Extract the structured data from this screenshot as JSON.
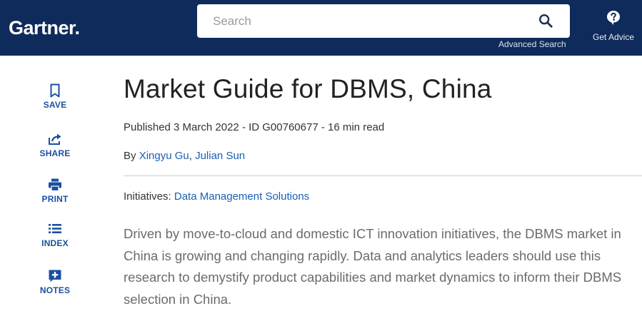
{
  "header": {
    "logo": "Gartner",
    "logo_dot": ".",
    "search": {
      "placeholder": "Search"
    },
    "advanced_search": "Advanced Search",
    "get_advice": "Get Advice",
    "colors": {
      "bar": "#0f2b5b",
      "accent": "#1a5fb4"
    }
  },
  "rail": {
    "save": {
      "label": "SAVE",
      "icon": "bookmark-icon"
    },
    "share": {
      "label": "SHARE",
      "icon": "share-icon"
    },
    "print": {
      "label": "PRINT",
      "icon": "print-icon"
    },
    "index": {
      "label": "INDEX",
      "icon": "list-icon"
    },
    "notes": {
      "label": "NOTES",
      "icon": "add-note-icon"
    }
  },
  "article": {
    "title": "Market Guide for DBMS, China",
    "meta": "Published 3 March 2022 - ID G00760677 - 16 min read",
    "by_prefix": "By ",
    "authors": [
      "Xingyu Gu",
      "Julian Sun"
    ],
    "author_sep": ", ",
    "initiatives_label": "Initiatives: ",
    "initiative": "Data Management Solutions",
    "summary": "Driven by move-to-cloud and domestic ICT innovation initiatives, the DBMS market in China is growing and changing rapidly. Data and analytics leaders should use this research to demystify product capabilities and market dynamics to inform their DBMS selection in China."
  }
}
